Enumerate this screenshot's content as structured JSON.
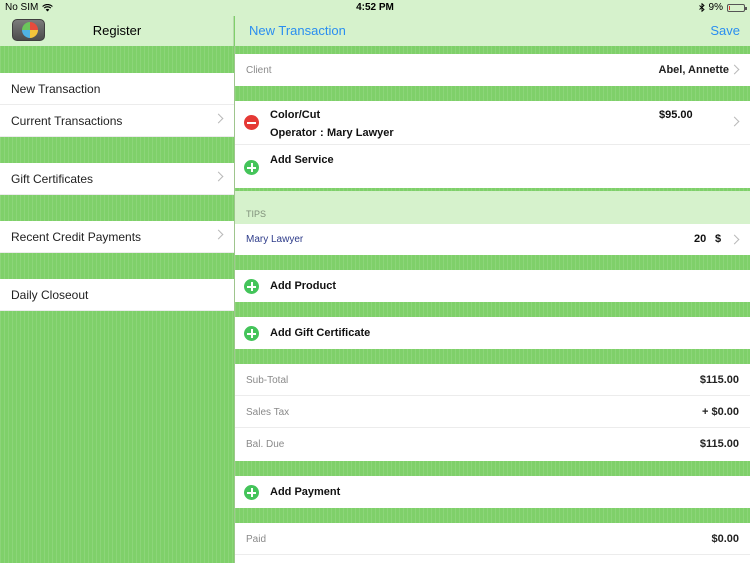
{
  "status_bar": {
    "carrier": "No SIM",
    "time": "4:52 PM",
    "battery": "9%",
    "battery_level": 0.09
  },
  "left_nav": {
    "title": "Register",
    "app_icon": "register-pie-icon"
  },
  "right_nav": {
    "back": "New Transaction",
    "save": "Save"
  },
  "menu": {
    "new_transaction": "New Transaction",
    "current_transactions": "Current Transactions",
    "gift_certificates": "Gift Certificates",
    "recent_credit_payments": "Recent Credit Payments",
    "daily_closeout": "Daily Closeout"
  },
  "transaction": {
    "client_label": "Client",
    "client_value": "Abel, Annette",
    "service": {
      "name": "Color/Cut",
      "price": "$95.00",
      "operator_label": "Operator",
      "operator_sep": ":",
      "operator_value": "Mary Lawyer"
    },
    "add_service": "Add Service",
    "tips_header": "TIPS",
    "tip": {
      "name": "Mary Lawyer",
      "amount": "20",
      "currency": "$"
    },
    "add_product": "Add Product",
    "add_gift_certificate": "Add Gift Certificate",
    "subtotal_label": "Sub-Total",
    "subtotal_value": "$115.00",
    "sales_tax_label": "Sales Tax",
    "sales_tax_value": "+ $0.00",
    "bal_due_label": "Bal. Due",
    "bal_due_value": "$115.00",
    "add_payment": "Add Payment",
    "paid_label": "Paid",
    "paid_value": "$0.00"
  },
  "colors": {
    "accent": "#2a8ef0",
    "green_bg": "#7fd06a",
    "bar_bg": "#d6f2cc",
    "add": "#44c45a",
    "remove": "#e53935"
  }
}
